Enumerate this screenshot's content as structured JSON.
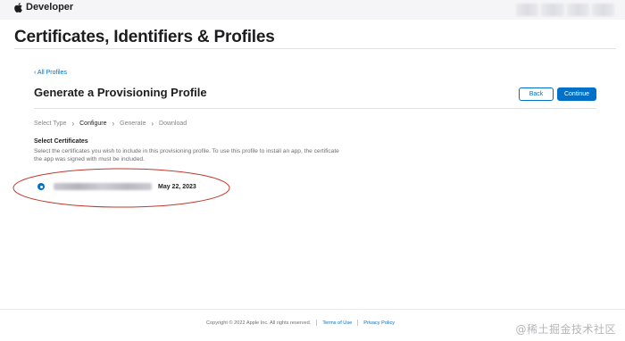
{
  "header": {
    "brand": "Developer",
    "brand_icon": "apple-logo-icon"
  },
  "page": {
    "title": "Certificates, Identifiers & Profiles"
  },
  "section": {
    "back_link": "‹ All Profiles",
    "title": "Generate a Provisioning Profile",
    "buttons": {
      "back": "Back",
      "continue": "Continue"
    }
  },
  "steps": [
    "Select Type",
    "Configure",
    "Generate",
    "Download"
  ],
  "active_step": "Configure",
  "certificates": {
    "heading": "Select Certificates",
    "description": "Select the certificates you wish to include in this provisioning profile. To use this profile to install an app, the certificate the app was signed with must be included.",
    "items": [
      {
        "date": "May 22, 2023",
        "selected": true
      }
    ]
  },
  "footer": {
    "copyright": "Copyright © 2022 Apple Inc. All rights reserved.",
    "terms": "Terms of Use",
    "privacy": "Privacy Policy"
  },
  "watermark": "@稀土掘金技术社区",
  "colors": {
    "accent": "#0070c9",
    "highlight": "#c0392b"
  }
}
